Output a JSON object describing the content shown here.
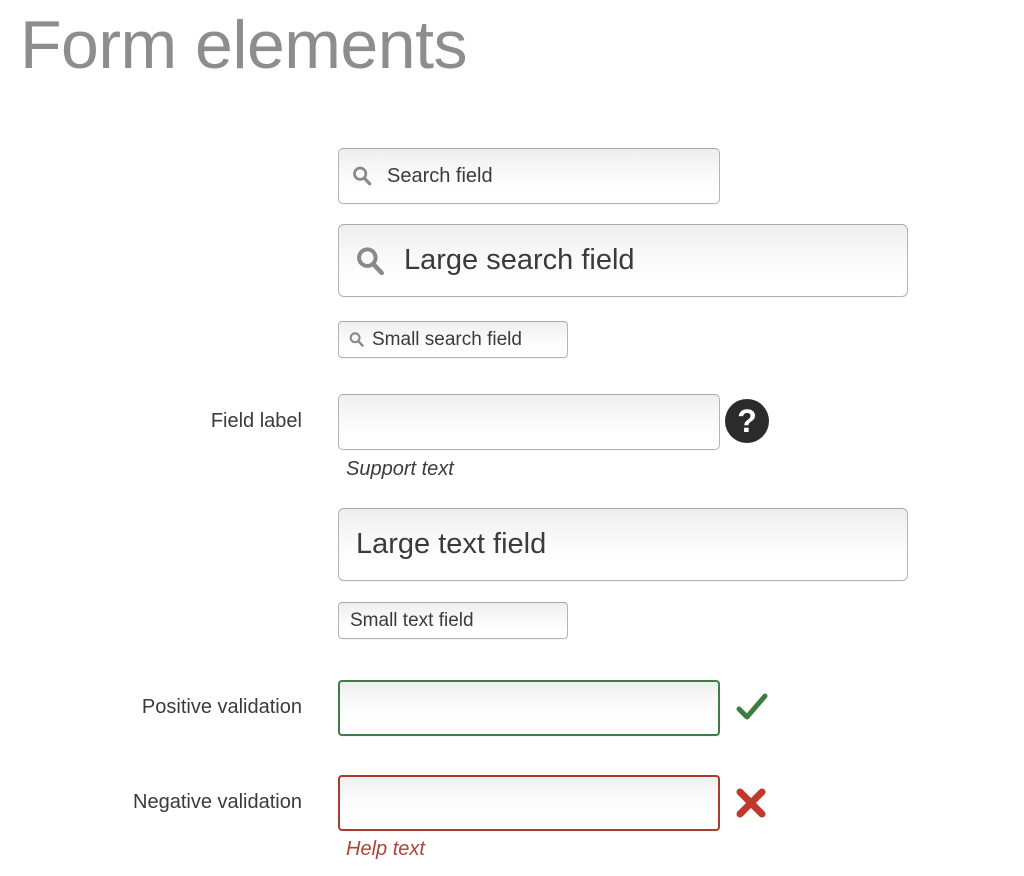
{
  "page": {
    "title": "Form elements",
    "title_color": "#8d8d8d",
    "background": "#ffffff"
  },
  "colors": {
    "text": "#3b3b3b",
    "field_border": "#b4b4b4",
    "positive": "#3f7d46",
    "negative": "#a83c30",
    "help_badge": "#2b2b2b"
  },
  "fields": {
    "search": {
      "label": "Search field",
      "placeholder": "Search field",
      "value": "",
      "icon": "search-icon",
      "size": "medium"
    },
    "large_search": {
      "label": "Large search field",
      "placeholder": "Large search field",
      "value": "",
      "icon": "search-icon",
      "size": "large"
    },
    "small_search": {
      "label": "Small search field",
      "placeholder": "Small search field",
      "value": "",
      "icon": "search-icon",
      "size": "small"
    },
    "field_label": {
      "label": "Field label",
      "placeholder": "",
      "value": "",
      "support_text": "Support text",
      "help_icon": "question-mark-icon",
      "size": "medium"
    },
    "large_text": {
      "label": "Large text field",
      "placeholder": "Large text field",
      "value": "",
      "size": "large"
    },
    "small_text": {
      "label": "Small text field",
      "placeholder": "Small text field",
      "value": "",
      "size": "small"
    },
    "positive_validation": {
      "label": "Positive validation",
      "placeholder": "",
      "value": "",
      "state": "valid",
      "status_icon": "checkmark-icon",
      "status_color": "#3f7d46"
    },
    "negative_validation": {
      "label": "Negative validation",
      "placeholder": "",
      "value": "",
      "state": "invalid",
      "status_icon": "cross-icon",
      "status_color": "#c0392b",
      "help_text": "Help text"
    }
  }
}
